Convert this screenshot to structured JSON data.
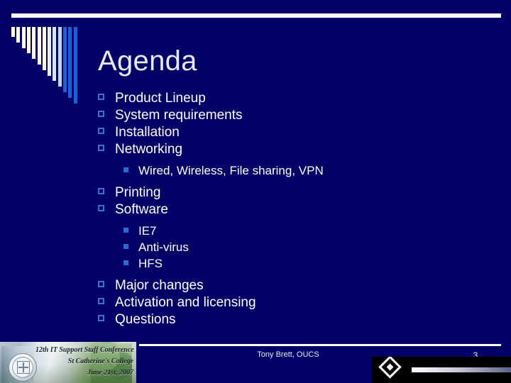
{
  "slide": {
    "background_color": "#000066",
    "title": "Agenda",
    "page_number": "3",
    "accent_bullet_color": "#3b6fd4",
    "rule_color": "#ffffff",
    "text_color": "#ffffff"
  },
  "decor": {
    "bar_colors": [
      "#fffce0",
      "#fffce0",
      "#fffce0",
      "#fffce0",
      "#fffce0",
      "#fffce0",
      "#fffce0",
      "#e8f1fb",
      "#d3e4fa",
      "#bcd7f7",
      "#1f5fd8",
      "#1f5fd8",
      "#1f5fd8"
    ],
    "bar_count": 13
  },
  "bullets": [
    {
      "level": 1,
      "text": "Product Lineup"
    },
    {
      "level": 1,
      "text": "System requirements"
    },
    {
      "level": 1,
      "text": "Installation"
    },
    {
      "level": 1,
      "text": "Networking"
    },
    {
      "level": 2,
      "text": "Wired, Wireless, File sharing, VPN"
    },
    {
      "level": 1,
      "text": "Printing"
    },
    {
      "level": 1,
      "text": "Software"
    },
    {
      "level": 2,
      "text": "IE7"
    },
    {
      "level": 2,
      "text": "Anti-virus"
    },
    {
      "level": 2,
      "text": "HFS"
    },
    {
      "level": 1,
      "text": "Major changes"
    },
    {
      "level": 1,
      "text": "Activation and licensing"
    },
    {
      "level": 1,
      "text": "Questions"
    }
  ],
  "footer": {
    "center_text": "Tony Brett, OUCS",
    "page_number": "3"
  },
  "conference_banner": {
    "line1": "12th IT Support Staff Conference",
    "line2": "St Catherine's College",
    "line3": "June 21st, 2007"
  }
}
